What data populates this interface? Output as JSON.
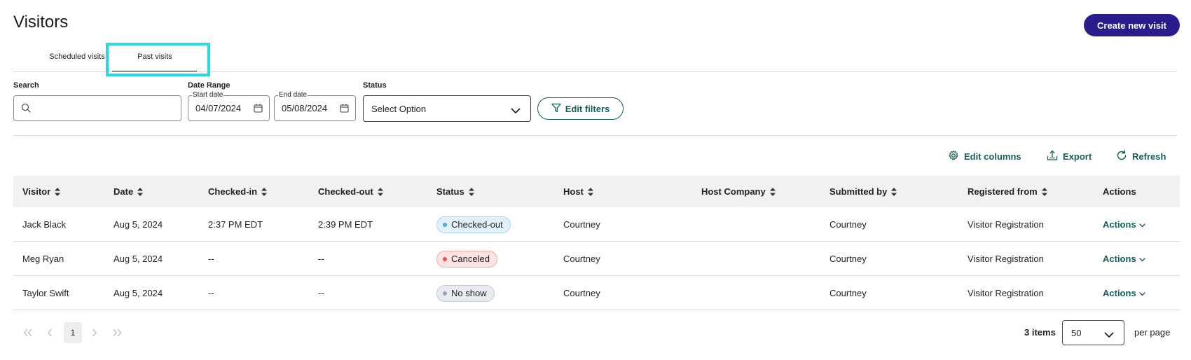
{
  "page": {
    "title": "Visitors",
    "create_button": "Create new visit"
  },
  "tabs": [
    {
      "label": "Scheduled visits",
      "active": false
    },
    {
      "label": "Past visits",
      "active": true
    }
  ],
  "filters": {
    "search_label": "Search",
    "search_value": "",
    "date_range_label": "Date Range",
    "start_date": {
      "legend": "Start date",
      "value": "04/07/2024"
    },
    "end_date": {
      "legend": "End date",
      "value": "05/08/2024"
    },
    "status_label": "Status",
    "status_value": "Select Option",
    "edit_filters": "Edit filters"
  },
  "toolbar": {
    "edit_columns": "Edit columns",
    "export": "Export",
    "refresh": "Refresh"
  },
  "table": {
    "columns": [
      "Visitor",
      "Date",
      "Checked-in",
      "Checked-out",
      "Status",
      "Host",
      "Host Company",
      "Submitted by",
      "Registered from",
      "Actions"
    ],
    "rows": [
      {
        "visitor": "Jack Black",
        "date": "Aug 5, 2024",
        "checked_in": "2:37 PM EDT",
        "checked_out": "2:39 PM EDT",
        "status": "Checked-out",
        "host": "Courtney",
        "host_company": "",
        "submitted_by": "Courtney",
        "registered_from": "Visitor Registration",
        "actions": "Actions"
      },
      {
        "visitor": "Meg Ryan",
        "date": "Aug 5, 2024",
        "checked_in": "--",
        "checked_out": "--",
        "status": "Canceled",
        "host": "Courtney",
        "host_company": "",
        "submitted_by": "Courtney",
        "registered_from": "Visitor Registration",
        "actions": "Actions"
      },
      {
        "visitor": "Taylor Swift",
        "date": "Aug 5, 2024",
        "checked_in": "--",
        "checked_out": "--",
        "status": "No show",
        "host": "Courtney",
        "host_company": "",
        "submitted_by": "Courtney",
        "registered_from": "Visitor Registration",
        "actions": "Actions"
      }
    ]
  },
  "status_colors": {
    "checked_out": {
      "bg": "#e1f1fb",
      "border": "#a9d6f0",
      "dot": "#4aa8e0"
    },
    "canceled": {
      "bg": "#fde4e3",
      "border": "#f3a9a6",
      "dot": "#e5544f"
    },
    "no_show": {
      "bg": "#e8ecf0",
      "border": "#c3cad2",
      "dot": "#9aa3ad"
    }
  },
  "pagination": {
    "current_page": "1",
    "items": "3 items",
    "per_page_value": "50",
    "per_page_label": "per page"
  },
  "colors": {
    "accent": "#135f5b",
    "primary_button": "#2a1c8c",
    "tab_highlight": "#27d9e0"
  },
  "icons": [
    "search-icon",
    "calendar-icon",
    "chevron-down-icon",
    "filter-icon",
    "gear-icon",
    "export-icon",
    "refresh-icon",
    "sort-icon",
    "first-page-icon",
    "prev-page-icon",
    "next-page-icon",
    "last-page-icon"
  ]
}
